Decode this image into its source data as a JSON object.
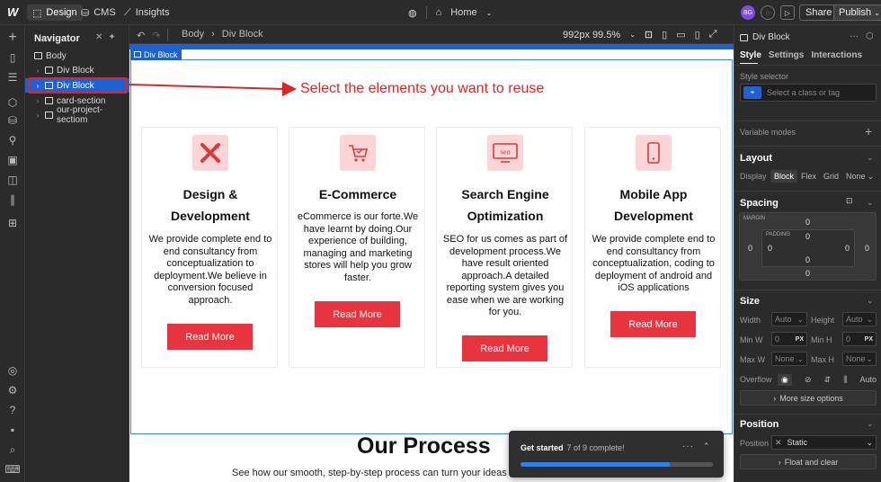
{
  "topbar": {
    "tabs": [
      {
        "label": "Design",
        "icon": "design-icon"
      },
      {
        "label": "CMS",
        "icon": "database-icon"
      },
      {
        "label": "Insights",
        "icon": "chart-icon"
      }
    ],
    "page_label": "Home",
    "avatar_initials": "BG",
    "share_label": "Share",
    "publish_label": "Publish"
  },
  "navigator": {
    "title": "Navigator",
    "items": [
      {
        "label": "Body",
        "depth": 0
      },
      {
        "label": "Div Block",
        "depth": 1
      },
      {
        "label": "Div Block",
        "depth": 1,
        "selected": true
      },
      {
        "label": "card-section",
        "depth": 1
      },
      {
        "label": "our-project-sectiom",
        "depth": 1
      }
    ]
  },
  "canvas_toolbar": {
    "breadcrumb": [
      "Body",
      "Div Block"
    ],
    "breakpoint_readout": "992px 99.5%"
  },
  "canvas": {
    "selected_tag": "Div Block",
    "annotation": "Select the elements you want to reuse",
    "annotation_color": "#e02424",
    "accent_button_color": "#e8343f",
    "cards": [
      {
        "title_lines": [
          "Design &",
          "Development"
        ],
        "text_lines": [
          "We provide complete end to",
          "end consultancy from",
          "conceptualization to",
          "deployment.We believe in",
          "conversion focused",
          "approach."
        ],
        "button": "Read More",
        "icon": "design-pencil-icon"
      },
      {
        "title_lines": [
          "E-Commerce"
        ],
        "text_lines": [
          "eCommerce is our forte.We",
          "have learnt by doing.Our",
          "experience of building,",
          "managing and marketing",
          "stores will help you grow",
          "faster."
        ],
        "button": "Read More",
        "icon": "shopping-cart-icon"
      },
      {
        "title_lines": [
          "Search Engine",
          "Optimization"
        ],
        "text_lines": [
          "SEO for us comes as part of",
          "development process.We",
          "have result oriented",
          "approach.A detailed",
          "reporting system gives you",
          "ease when we are working",
          "for you."
        ],
        "button": "Read More",
        "icon": "seo-monitor-icon"
      },
      {
        "title_lines": [
          "Mobile App",
          "Development"
        ],
        "text_lines": [
          "We provide complete end to",
          "end consultancy from",
          "conceptualization, coding to",
          "deployment of android and",
          "iOS applications"
        ],
        "button": "Read More",
        "icon": "mobile-phone-icon"
      }
    ],
    "process_title": "Our Process",
    "process_subtitle": "See how our smooth, step-by-step process can turn your ideas in"
  },
  "toast": {
    "title": "Get started",
    "progress_text": "7 of 9 complete!",
    "progress_fraction": 0.7778
  },
  "right_panel": {
    "element_label": "Div Block",
    "tabs": [
      "Style",
      "Settings",
      "Interactions"
    ],
    "style_selector_label": "Style selector",
    "style_selector_placeholder": "Select a class or tag",
    "variable_modes_label": "Variable modes",
    "layout": {
      "title": "Layout",
      "display_label": "Display",
      "options": [
        "Block",
        "Flex",
        "Grid",
        "None"
      ],
      "selected": "Block"
    },
    "spacing": {
      "title": "Spacing",
      "margin_label": "MARGIN",
      "padding_label": "PADDING",
      "margin": {
        "top": "0",
        "right": "0",
        "bottom": "0",
        "left": "0"
      },
      "padding": {
        "top": "0",
        "right": "0",
        "bottom": "0",
        "left": "0"
      }
    },
    "size": {
      "title": "Size",
      "width_label": "Width",
      "width_value": "Auto",
      "height_label": "Height",
      "height_value": "Auto",
      "minw_label": "Min W",
      "minw_value": "0",
      "minw_unit": "PX",
      "minh_label": "Min H",
      "minh_value": "0",
      "minh_unit": "PX",
      "maxw_label": "Max W",
      "maxw_value": "None",
      "maxh_label": "Max H",
      "maxh_value": "None",
      "overflow_label": "Overflow",
      "overflow_auto": "Auto",
      "more_label": "More size options"
    },
    "position": {
      "title": "Position",
      "label": "Position",
      "value": "Static",
      "float_label": "Float and clear"
    }
  }
}
